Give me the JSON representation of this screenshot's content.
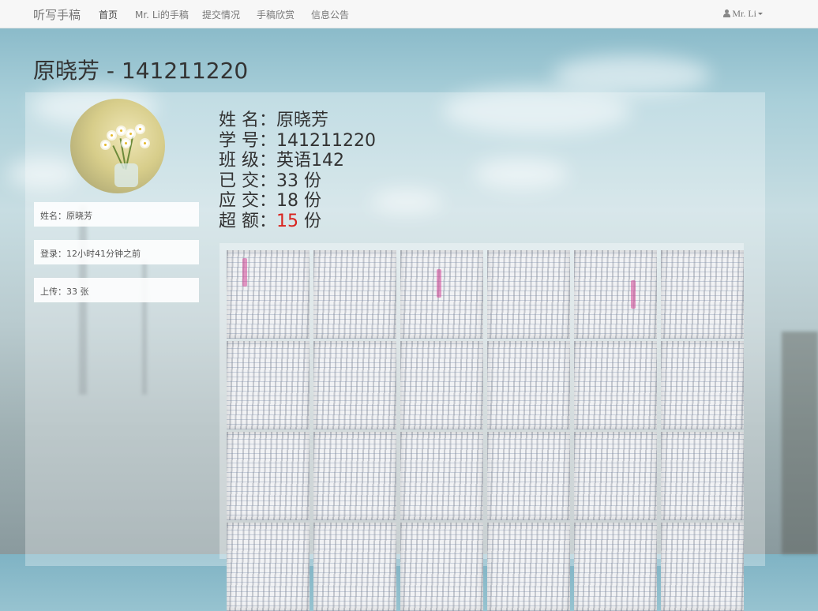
{
  "navbar": {
    "brand": "听写手稿",
    "items": [
      {
        "label": "首页"
      },
      {
        "label": "Mr. Li的手稿"
      },
      {
        "label": "提交情况"
      },
      {
        "label": "手稿欣赏"
      },
      {
        "label": "信息公告"
      }
    ],
    "active_index": 0,
    "user": "Mr.  Li"
  },
  "page_title": "原晓芳 - 141211220",
  "sidebar": {
    "name": "姓名：原晓芳",
    "login": "登录：12小时41分钟之前",
    "upload": "上传：33 张"
  },
  "details": {
    "name_label": "姓 名：",
    "name_value": "原晓芳",
    "id_label": "学 号：",
    "id_value": "141211220",
    "class_label": "班 级：",
    "class_value": "英语142",
    "submitted_label": "已 交：",
    "submitted_value": "33 份",
    "required_label": "应 交：",
    "required_value": "18 份",
    "extra_label": "超 额：",
    "extra_value": "15",
    "extra_unit": " 份"
  },
  "colors": {
    "extra_highlight": "#d9231e",
    "navbar_bg": "#f7f7f7"
  },
  "gallery": {
    "thumbnail_count": 24
  }
}
